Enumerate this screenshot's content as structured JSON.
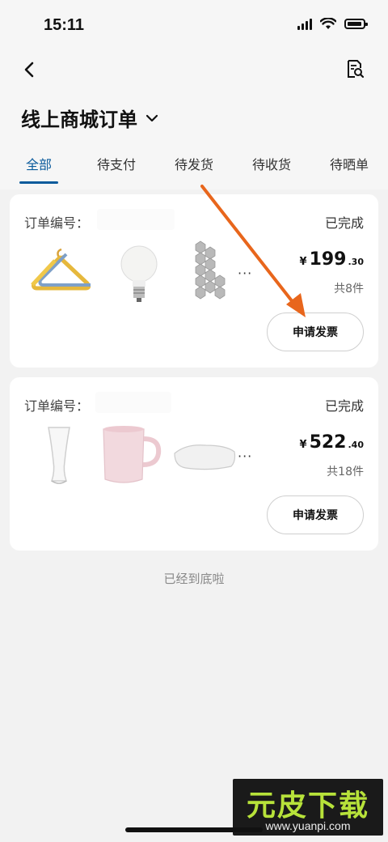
{
  "status_bar": {
    "time": "15:11"
  },
  "header": {
    "title": "线上商城订单"
  },
  "tabs": [
    {
      "label": "全部",
      "active": true
    },
    {
      "label": "待支付"
    },
    {
      "label": "待发货"
    },
    {
      "label": "待收货"
    },
    {
      "label": "待晒单"
    }
  ],
  "orders": [
    {
      "number_label": "订单编号：",
      "status": "已完成",
      "currency": "¥",
      "price_int": "199",
      "price_dec": ".30",
      "count": "共8件",
      "items": [
        "clothes-hanger",
        "light-bulb",
        "hexagon-mirror-tiles"
      ],
      "more": "···",
      "button": "申请发票"
    },
    {
      "number_label": "订单编号：",
      "status": "已完成",
      "currency": "¥",
      "price_int": "522",
      "price_dec": ".40",
      "count": "共18件",
      "items": [
        "beer-glass",
        "pink-mug",
        "pillow"
      ],
      "more": "···",
      "button": "申请发票"
    }
  ],
  "footer_text": "已经到底啦",
  "watermark": {
    "title": "元皮下载",
    "url": "www.yuanpi.com"
  },
  "colors": {
    "accent": "#0a5b9c",
    "arrow": "#e8661c",
    "watermark_green": "#b7e23a"
  }
}
